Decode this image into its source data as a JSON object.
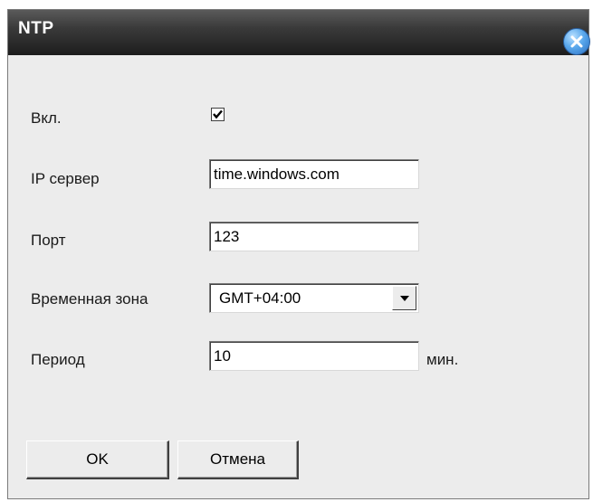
{
  "window": {
    "title": "NTP",
    "close_icon": "close-icon"
  },
  "form": {
    "enable": {
      "label": "Вкл.",
      "checked": true
    },
    "server": {
      "label": "IP сервер",
      "value": "time.windows.com"
    },
    "port": {
      "label": "Порт",
      "value": "123"
    },
    "timezone": {
      "label": "Временная зона",
      "value": "GMT+04:00"
    },
    "period": {
      "label": "Период",
      "value": "10",
      "unit": "мин."
    }
  },
  "buttons": {
    "ok_label": "OK",
    "cancel_label": "Отмена"
  },
  "colors": {
    "titlebar": "#1d1d1d",
    "dialog_bg": "#ececec",
    "close_button": "#3a8ad8"
  }
}
